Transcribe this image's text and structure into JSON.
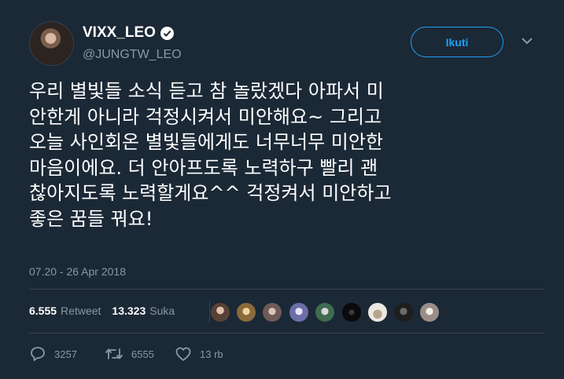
{
  "tweet": {
    "display_name": "VIXX_LEO",
    "username": "@JUNGTW_LEO",
    "follow_label": "Ikuti",
    "text_lines": [
      "우리 별빛들 소식 듣고 참 놀랐겠다 아파서 미",
      "안한게 아니라 걱정시켜서 미안해요~ 그리고",
      "오늘 사인회온 별빛들에게도 너무너무 미안한",
      "마음이에요. 더 안아프도록 노력하구 빨리 괜",
      "찮아지도록 노력할게요^^ 걱정켜서 미안하고",
      "좋은 꿈들 꿔요!"
    ],
    "timestamp": "07.20 - 26 Apr 2018"
  },
  "stats": {
    "retweets_count": "6.555",
    "retweets_label": "Retweet",
    "likes_count": "13.323",
    "likes_label": "Suka"
  },
  "actions": {
    "reply_count": "3257",
    "retweet_count": "6555",
    "like_count": "13 rb"
  },
  "icons": [
    "verified-icon",
    "chevron-down-icon",
    "reply-icon",
    "retweet-icon",
    "heart-icon"
  ],
  "colors": {
    "background": "#1b2836",
    "accent": "#1da1f2",
    "secondary_text": "#8899a6",
    "divider": "#38444d"
  }
}
